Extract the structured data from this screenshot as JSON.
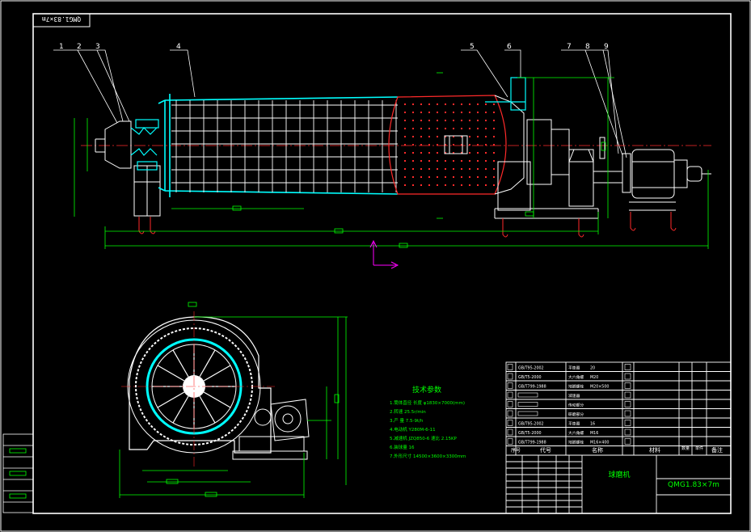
{
  "drawing": {
    "corner_label": "QMG1.83×7m",
    "balloons": [
      "1",
      "2",
      "3",
      "4",
      "5",
      "6",
      "7",
      "8",
      "9"
    ]
  },
  "tech_params": {
    "title": "技术参数",
    "lines": [
      "1.筒体直径 长度 φ1830×7000(mm)",
      "2.转速 25.5r/min",
      "3.产 量 7.5-9t/h",
      "4.电动机 Y280M-6-11",
      "5.减速机 JZQ850-6 速比 2.15KP",
      "6.装球量 16",
      "7.外形尺寸 14500×3600×3300mm"
    ]
  },
  "title_block": {
    "header": [
      "序号",
      "代号",
      "名称",
      "材料",
      "数量",
      "单件",
      "备注"
    ],
    "rows": [
      {
        "code": "GB/T95-2002",
        "name": "平垫圈",
        "spec": "20"
      },
      {
        "code": "GB/T5-2000",
        "name": "大六角螺",
        "spec": "M20"
      },
      {
        "code": "GB/T799-1988",
        "name": "地脚螺栓",
        "spec": "M20×500"
      },
      {
        "code": "",
        "name": "减速器",
        "spec": ""
      },
      {
        "code": "",
        "name": "传动部分",
        "spec": ""
      },
      {
        "code": "",
        "name": "研磨部分",
        "spec": ""
      },
      {
        "code": "GB/T95-2002",
        "name": "平垫圈",
        "spec": "16"
      },
      {
        "code": "GB/T5-2000",
        "name": "大六角螺",
        "spec": "M16"
      },
      {
        "code": "GB/T799-1988",
        "name": "地脚螺栓",
        "spec": "M16×400"
      }
    ],
    "drawing_name": "球磨机",
    "drawing_code": "QMG1.83×7m"
  },
  "colors": {
    "background": "#000000",
    "frame": "#ffffff",
    "shell": "#00ffff",
    "liner": "#ff2a2a",
    "dimension": "#00ff00",
    "accent": "#ff00ff",
    "text": "#ffffff"
  }
}
